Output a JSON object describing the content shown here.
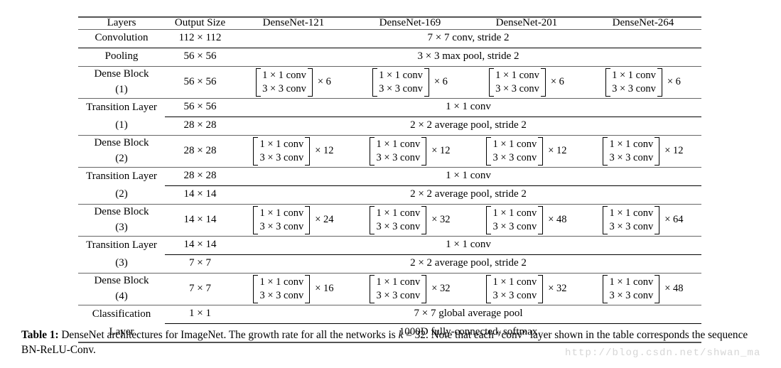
{
  "table": {
    "headers": [
      "Layers",
      "Output Size",
      "DenseNet-121",
      "DenseNet-169",
      "DenseNet-201",
      "DenseNet-264"
    ],
    "rows": {
      "convolution": {
        "layer": "Convolution",
        "output_size": "112 × 112",
        "spanned": "7 × 7 conv, stride 2"
      },
      "pooling": {
        "layer": "Pooling",
        "output_size": "56 × 56",
        "spanned": "3 × 3 max pool, stride 2"
      },
      "dense_block_1": {
        "layer_line1": "Dense Block",
        "layer_line2": "(1)",
        "output_size": "56 × 56",
        "bracket_line1": "1 × 1 conv",
        "bracket_line2": "3 × 3 conv",
        "multipliers": [
          "× 6",
          "× 6",
          "× 6",
          "× 6"
        ]
      },
      "transition_layer_1": {
        "layer_line1": "Transition Layer",
        "layer_line2": "(1)",
        "output_size_a": "56 × 56",
        "output_size_b": "28 × 28",
        "spanned_a": "1 × 1 conv",
        "spanned_b": "2 × 2 average pool, stride 2"
      },
      "dense_block_2": {
        "layer_line1": "Dense Block",
        "layer_line2": "(2)",
        "output_size": "28 × 28",
        "bracket_line1": "1 × 1 conv",
        "bracket_line2": "3 × 3 conv",
        "multipliers": [
          "× 12",
          "× 12",
          "× 12",
          "× 12"
        ]
      },
      "transition_layer_2": {
        "layer_line1": "Transition Layer",
        "layer_line2": "(2)",
        "output_size_a": "28 × 28",
        "output_size_b": "14 × 14",
        "spanned_a": "1 × 1 conv",
        "spanned_b": "2 × 2 average pool, stride 2"
      },
      "dense_block_3": {
        "layer_line1": "Dense Block",
        "layer_line2": "(3)",
        "output_size": "14 × 14",
        "bracket_line1": "1 × 1 conv",
        "bracket_line2": "3 × 3 conv",
        "multipliers": [
          "× 24",
          "× 32",
          "× 48",
          "× 64"
        ]
      },
      "transition_layer_3": {
        "layer_line1": "Transition Layer",
        "layer_line2": "(3)",
        "output_size_a": "14 × 14",
        "output_size_b": "7 × 7",
        "spanned_a": "1 × 1 conv",
        "spanned_b": "2 × 2 average pool, stride 2"
      },
      "dense_block_4": {
        "layer_line1": "Dense Block",
        "layer_line2": "(4)",
        "output_size": "7 × 7",
        "bracket_line1": "1 × 1 conv",
        "bracket_line2": "3 × 3 conv",
        "multipliers": [
          "× 16",
          "× 32",
          "× 32",
          "× 48"
        ]
      },
      "classification_layer": {
        "layer_line1": "Classification",
        "layer_line2": "Layer",
        "output_size_a": "1 × 1",
        "output_size_b": "",
        "spanned_a": "7 × 7 global average pool",
        "spanned_b": "1000D fully-connected, softmax"
      }
    }
  },
  "caption": {
    "label": "Table 1:",
    "text_part1": " DenseNet architectures for ImageNet. The growth rate for all the networks is ",
    "math_k": "k",
    "math_eq": " = ",
    "math_val": "32",
    "text_part2": ". Note that each “conv” layer shown in the table corresponds the sequence BN-ReLU-Conv."
  },
  "watermark": {
    "text": "http://blog.csdn.net/shwan_ma"
  }
}
